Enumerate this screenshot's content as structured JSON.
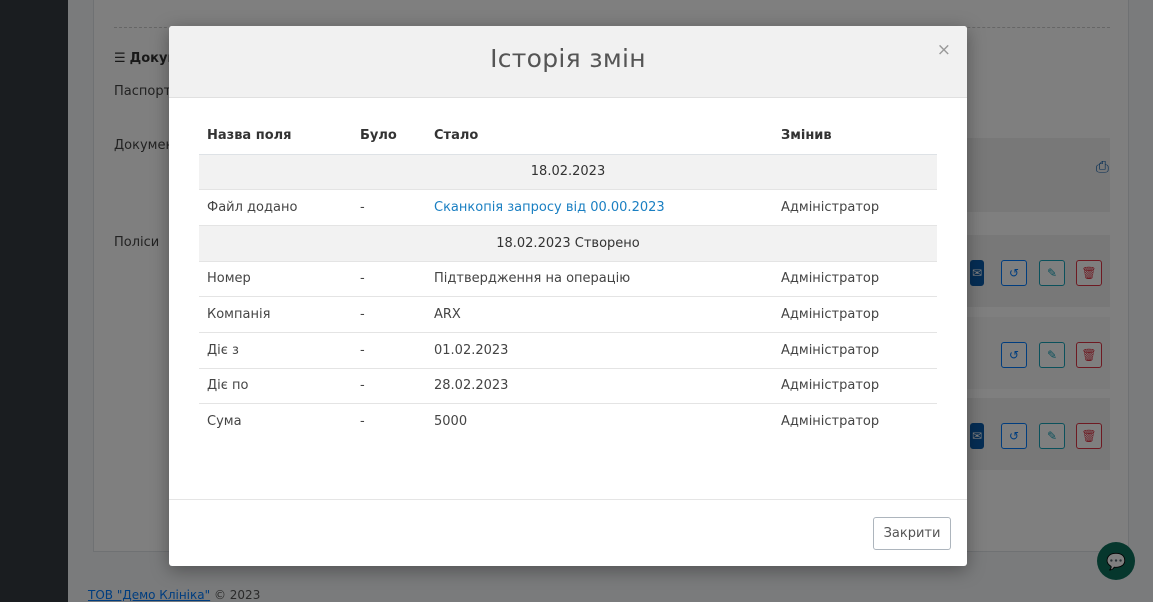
{
  "background": {
    "section_heading": "Докум",
    "labels": [
      "Паспорт",
      "Докумен",
      "Поліси"
    ],
    "footer_link": "ТОВ \"Демо Клініка\"",
    "footer_copy": "© 2023"
  },
  "modal": {
    "title": "Історія змін",
    "close_symbol": "×",
    "columns": [
      "Назва поля",
      "Було",
      "Стало",
      "Змінив"
    ],
    "groups": [
      {
        "date": "18.02.2023",
        "rows": [
          {
            "field": "Файл додано",
            "old": "-",
            "new": "Сканкопія запросу від 00.00.2023",
            "user": "Адміністратор",
            "is_link": true
          }
        ]
      },
      {
        "date": "18.02.2023 Створено",
        "rows": [
          {
            "field": "Номер",
            "old": "-",
            "new": "Підтвердження на операцію",
            "user": "Адміністратор"
          },
          {
            "field": "Компанія",
            "old": "-",
            "new": "ARX",
            "user": "Адміністратор"
          },
          {
            "field": "Діє з",
            "old": "-",
            "new": "01.02.2023",
            "user": "Адміністратор"
          },
          {
            "field": "Діє по",
            "old": "-",
            "new": "28.02.2023",
            "user": "Адміністратор"
          },
          {
            "field": "Сума",
            "old": "-",
            "new": "5000",
            "user": "Адміністратор"
          }
        ]
      }
    ],
    "footer_button": "Закрити"
  }
}
